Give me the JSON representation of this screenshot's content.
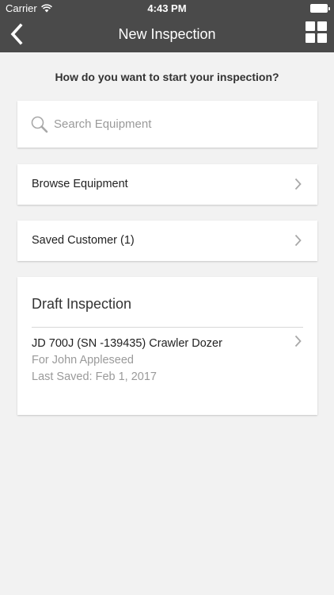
{
  "status_bar": {
    "carrier": "Carrier",
    "time": "4:43 PM"
  },
  "nav": {
    "title": "New Inspection",
    "back_icon": "chevron-left-icon",
    "menu_icon": "grid-icon"
  },
  "prompt": "How do you want to start your inspection?",
  "search": {
    "placeholder": "Search Equipment",
    "value": ""
  },
  "options": {
    "browse_label": "Browse Equipment",
    "saved_customer_label": "Saved Customer (1)"
  },
  "draft": {
    "title": "Draft Inspection",
    "item": {
      "name": "JD 700J (SN -139435) Crawler Dozer",
      "customer": "For John Appleseed",
      "last_saved": "Last Saved: Feb 1, 2017"
    }
  },
  "colors": {
    "nav_bar": "#4a4a4a",
    "background": "#f2f2f2",
    "card": "#ffffff",
    "secondary_text": "#9a9a9a"
  }
}
